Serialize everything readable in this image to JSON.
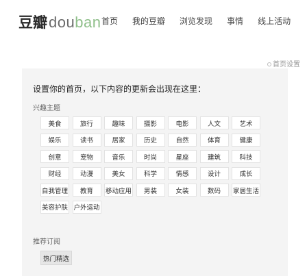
{
  "logo": {
    "cn": "豆瓣",
    "en_dark": "dou",
    "en_green": "ban"
  },
  "nav": [
    "首页",
    "我的豆瓣",
    "浏览发现",
    "事情",
    "线上活动"
  ],
  "settings_link": "首页设置",
  "intro": "设置你的首页，以下内容的更新会出现在这里：",
  "interest_section": {
    "label": "兴趣主题",
    "tags": [
      "美食",
      "旅行",
      "趣味",
      "摄影",
      "电影",
      "人文",
      "艺术",
      "娱乐",
      "读书",
      "居家",
      "历史",
      "自然",
      "体育",
      "健康",
      "创意",
      "宠物",
      "音乐",
      "时尚",
      "星座",
      "建筑",
      "科技",
      "财经",
      "动漫",
      "美女",
      "科学",
      "情感",
      "设计",
      "成长",
      "自我管理",
      "教育",
      "移动应用",
      "男装",
      "女装",
      "数码",
      "家居生活",
      "美容护肤",
      "户外运动"
    ]
  },
  "recommend_section": {
    "label": "推荐订阅",
    "featured": "热门精选"
  }
}
